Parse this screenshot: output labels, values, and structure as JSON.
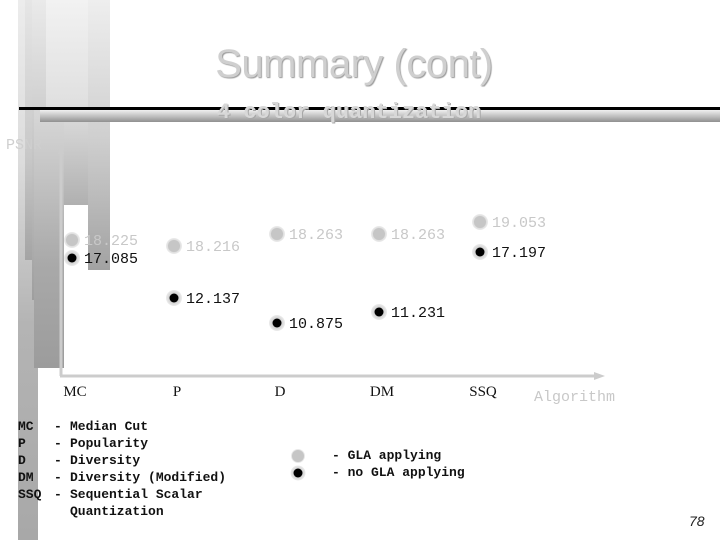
{
  "slide": {
    "title": "Summary (cont)",
    "subtitle": "4 color quantization",
    "page_number": "78"
  },
  "chart_data": {
    "type": "scatter",
    "title": "4 color quantization",
    "xlabel": "Algorithm",
    "ylabel": "PSNR",
    "categories": [
      "MC",
      "P",
      "D",
      "DM",
      "SSQ"
    ],
    "series": [
      {
        "name": "GLA applying",
        "marker": "light-grey-dot",
        "color": "#c8c8c8",
        "values": [
          18.225,
          18.216,
          18.263,
          18.263,
          19.053
        ],
        "labels": [
          "18.225",
          "18.216",
          "18.263",
          "18.263",
          "19.053"
        ]
      },
      {
        "name": "no GLA applying",
        "marker": "black-dot",
        "color": "#000000",
        "values": [
          17.085,
          12.137,
          10.875,
          11.231,
          17.197
        ],
        "labels": [
          "17.085",
          "12.137",
          "10.875",
          "11.231",
          "17.197"
        ]
      }
    ],
    "grid": false,
    "legend": "bottom-center"
  },
  "abbreviations": [
    {
      "key": "MC",
      "dash": "-",
      "desc": "Median Cut"
    },
    {
      "key": "P",
      "dash": "-",
      "desc": "Popularity"
    },
    {
      "key": "D",
      "dash": "-",
      "desc": "Diversity"
    },
    {
      "key": "DM",
      "dash": "-",
      "desc": "Diversity (Modified)"
    },
    {
      "key": "SSQ",
      "dash": "-",
      "desc": "Sequential Scalar"
    },
    {
      "key": "",
      "dash": "",
      "desc": "Quantization"
    }
  ],
  "legend": [
    {
      "label": "- GLA applying",
      "icon": "light-grey-dot"
    },
    {
      "label": "- no GLA applying",
      "icon": "black-dot"
    }
  ]
}
